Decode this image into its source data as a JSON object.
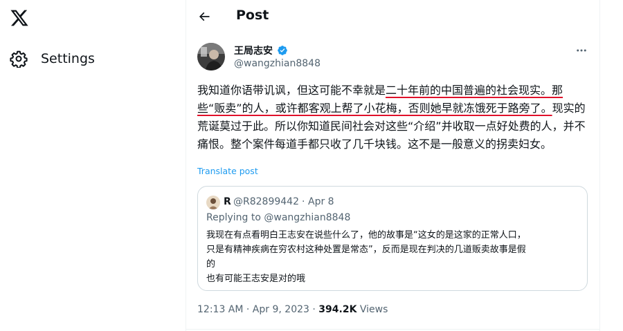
{
  "nav": {
    "logo_icon": "x-logo-icon",
    "settings_label": "Settings",
    "settings_icon": "gear-icon"
  },
  "header": {
    "title": "Post",
    "back_icon": "back-arrow-icon"
  },
  "post": {
    "author_name": "王局志安",
    "author_handle": "@wangzhian8848",
    "verified": true,
    "text_segments": [
      {
        "text": "我知道你语带讥讽，但这可能不幸就是",
        "underline": false
      },
      {
        "text": "二十年前的中国普遍的社会现实。那些“贩卖”的人，或许都客观上帮了小花梅，否则她早就冻饿死于路旁了。",
        "underline": true
      },
      {
        "text": "现实的荒诞莫过于此。所以你知道民间社会对这些“介绍”并收取一点好处费的人，并不痛恨。整个案件每道手都只收了几千块钱。这不是一般意义的拐卖妇女。",
        "underline": false
      }
    ],
    "translate_label": "Translate post",
    "timestamp": "12:13 AM · Apr 9, 2023",
    "separator": " · ",
    "views_count": "394.2K",
    "views_label": "Views"
  },
  "quote": {
    "author_name": "R",
    "author_handle": "@R82899442",
    "separator": "·",
    "date": "Apr 8",
    "replying_to": "Replying to @wangzhian8848",
    "lines": [
      "我现在有点看明白王志安在说些什么了，他的故事是“这女的是这家的正常人口，",
      "只是有精神疾病在穷农村这种处置是常态”，反而是现在判决的几道贩卖故事是假",
      "的",
      "也有可能王志安是对的哦"
    ]
  },
  "colors": {
    "accent": "#1d9bf0",
    "underline": "#e0102a",
    "secondary_text": "#536471",
    "border": "#cfd9de"
  }
}
